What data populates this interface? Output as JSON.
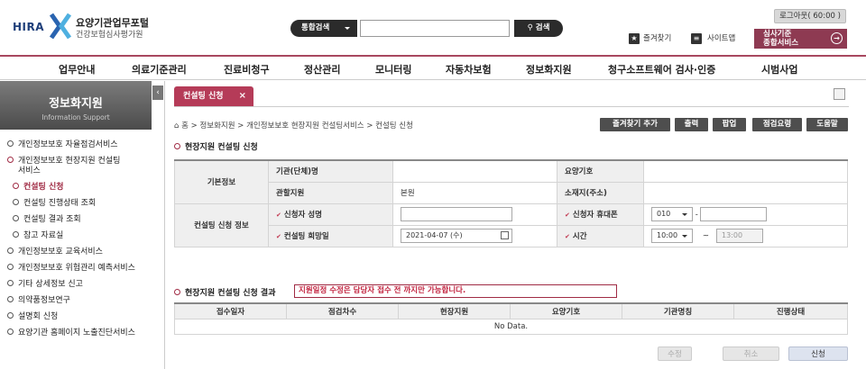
{
  "header": {
    "logo_en": "HIRA",
    "logo_title": "요양기관업무포털",
    "logo_sub": "건강보험심사평가원",
    "search_scope": "통합검색",
    "search_value": "",
    "search_button": "검색",
    "logout": "로그아웃( 60:00 )",
    "favorites": "즐겨찾기",
    "sitemap": "사이트맵",
    "service_line1": "심사기준",
    "service_line2": "종합서비스"
  },
  "gnb": [
    "업무안내",
    "의료기준관리",
    "진료비청구",
    "정산관리",
    "모니터링",
    "자동차보험",
    "정보화지원",
    "청구소프트웨어 검사·인증",
    "시범사업"
  ],
  "sidebar": {
    "title": "정보화지원",
    "subtitle": "Information Support",
    "items": [
      {
        "label": "개인정보보호 자율점검서비스"
      },
      {
        "label": "개인정보보호 현장지원 컨설팅"
      },
      {
        "label": "서비스"
      },
      {
        "label": "컨설팅 신청"
      },
      {
        "label": "컨설팅 진행상태 조회"
      },
      {
        "label": "컨설팅 결과 조회"
      },
      {
        "label": "참고 자료실"
      },
      {
        "label": "개인정보보호 교육서비스"
      },
      {
        "label": "개인정보보호 위험관리 예측서비스"
      },
      {
        "label": "기타 상세정보 신고"
      },
      {
        "label": "의약품정보연구"
      },
      {
        "label": "설명회 신청"
      },
      {
        "label": "요양기관 홈페이지 노출진단서비스"
      }
    ]
  },
  "tab": {
    "label": "컨설팅 신청",
    "close": "×"
  },
  "breadcrumb": {
    "home": "홈",
    "path": "정보화지원 > 개인정보보호 현장지원 컨설팅서비스 > 컨설팅 신청"
  },
  "toolbar": {
    "add_favorite": "즐겨찾기 추가",
    "print": "출력",
    "popup": "팝업",
    "checklist": "점검요령",
    "help": "도움말"
  },
  "form_section": {
    "title": "현장지원 컨설팅 신청",
    "basic_info": "기본정보",
    "org_name_label": "기관(단체)명",
    "org_name_value": "",
    "code_label": "요양기호",
    "code_value": "",
    "branch_label": "관할지원",
    "branch_value": "본원",
    "address_label": "소재지(주소)",
    "address_value": "",
    "apply_info": "컨설팅 신청 정보",
    "applicant_label": "신청자 성명",
    "applicant_value": "",
    "phone_label": "신청자 휴대폰",
    "phone_prefix": "010",
    "phone_dash": "-",
    "phone_rest": "",
    "date_label": "컨설팅 희망일",
    "date_value": "2021-04-07 (수)",
    "time_label": "시간",
    "time_start": "10:00",
    "time_tilde": "~",
    "time_end": "13:00"
  },
  "result_section": {
    "title": "현장지원 컨설팅 신청 결과",
    "notice": "지원일정 수정은 담당자 접수 전 까지만 가능합니다.",
    "columns": [
      "접수일자",
      "점검차수",
      "현장지원",
      "요양기호",
      "기관명칭",
      "진행상태"
    ],
    "empty": "No Data."
  },
  "actions": {
    "edit": "수정",
    "cancel": "취소",
    "apply": "신청"
  },
  "colors": {
    "accent": "#a8485f",
    "tab": "#b53b58",
    "dark_button": "#4e4e4e"
  }
}
